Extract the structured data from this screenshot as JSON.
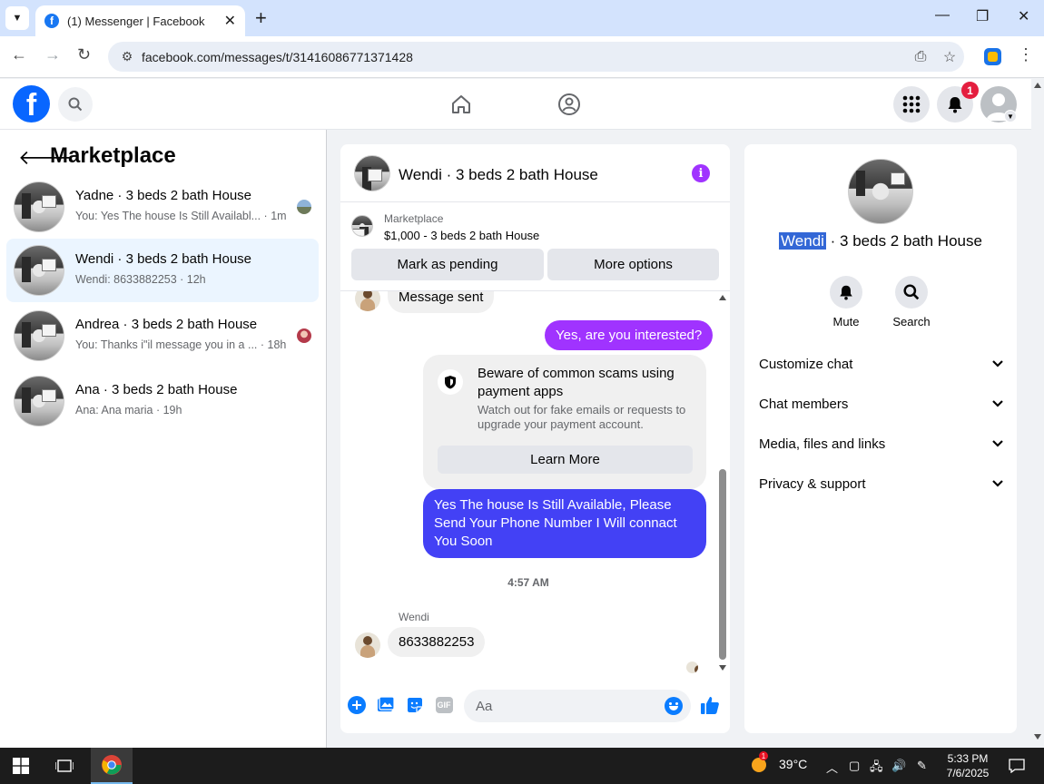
{
  "browser": {
    "tab_title": "(1) Messenger | Facebook",
    "url": "facebook.com/messages/t/31416086771371428"
  },
  "header": {
    "notification_count": "1"
  },
  "sidebar": {
    "title": "Marketplace",
    "chats": [
      {
        "name": "Yadne · 3 beds 2 bath House",
        "preview": "You: Yes The house Is Still Availabl... · 1m"
      },
      {
        "name": "Wendi · 3 beds 2 bath House",
        "preview": "Wendi: 8633882253 · 12h"
      },
      {
        "name": "Andrea · 3 beds 2 bath House",
        "preview": "You: Thanks i\"il message you in a ... · 18h"
      },
      {
        "name": "Ana · 3 beds 2 bath House",
        "preview": "Ana: Ana maria · 19h"
      }
    ]
  },
  "chat": {
    "title": "Wendi · 3 beds 2 bath House",
    "marketplace_label": "Marketplace",
    "listing": "$1,000 - 3 beds 2 bath House",
    "mark_pending": "Mark as pending",
    "more_options": "More options",
    "messages": {
      "partial_in": "Message sent",
      "out_question": "Yes, are you interested?",
      "scam_title": "Beware of common scams using payment apps",
      "scam_sub": "Watch out for fake emails or requests to upgrade your payment account.",
      "learn_more": "Learn More",
      "out_reply": "Yes The house Is Still Available, Please Send Your Phone Number I Will connact You Soon",
      "timestamp": "4:57 AM",
      "sender": "Wendi",
      "in_phone": "8633882253"
    },
    "composer_placeholder": "Aa",
    "gif_label": "GIF"
  },
  "details": {
    "name_highlight": "Wendi",
    "name_rest": " · 3 beds 2 bath House",
    "mute": "Mute",
    "search": "Search",
    "sections": [
      "Customize chat",
      "Chat members",
      "Media, files and links",
      "Privacy & support"
    ]
  },
  "taskbar": {
    "temperature": "39°C",
    "weather_badge": "1",
    "time": "5:33 PM",
    "date": "7/6/2025"
  },
  "colors": {
    "brand": "#0866ff",
    "accent_purple": "#a033ff",
    "outgoing_blue": "#4341f5",
    "badge_red": "#e41e3f"
  }
}
